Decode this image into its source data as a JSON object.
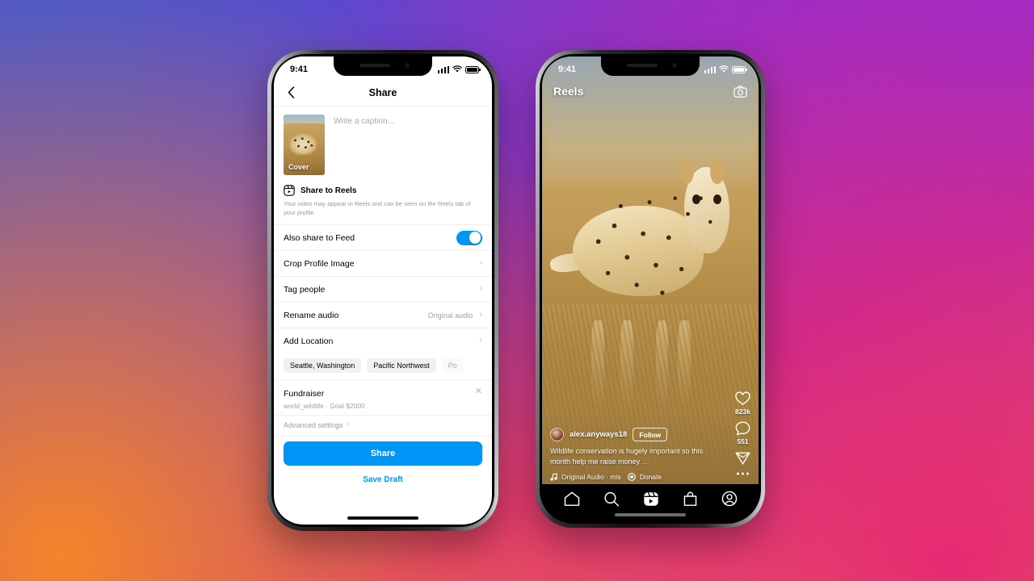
{
  "background": {
    "gradient_colors": [
      "#4055d4",
      "#5b45cf",
      "#a32bc4",
      "#d6297f",
      "#e62a72",
      "#f58529"
    ]
  },
  "accent": {
    "primary": "#0095f6",
    "toggle_on": "#0095f6"
  },
  "left_phone": {
    "status_bar": {
      "time": "9:41",
      "signal_icon": "cellular-bars-icon",
      "wifi_icon": "wifi-icon",
      "battery_icon": "battery-icon"
    },
    "nav": {
      "back_icon": "chevron-left-icon",
      "title": "Share"
    },
    "composer": {
      "cover_label": "Cover",
      "caption_placeholder": "Write a caption...",
      "caption_value": ""
    },
    "share_to_reels": {
      "icon": "reels-icon",
      "title": "Share to Reels",
      "description": "Your video may appear in Reels and can be seen on the Reels tab of your profile."
    },
    "settings_rows": [
      {
        "label": "Also share to Feed",
        "control": "toggle",
        "toggle_on": true
      },
      {
        "label": "Crop Profile Image",
        "control": "chevron",
        "value": ""
      },
      {
        "label": "Tag people",
        "control": "chevron",
        "value": ""
      },
      {
        "label": "Rename audio",
        "control": "chevron",
        "value": "Original audio"
      },
      {
        "label": "Add Location",
        "control": "chevron",
        "value": ""
      }
    ],
    "location_chips": [
      {
        "label": "Seattle, Washington",
        "cut_off": false
      },
      {
        "label": "Pacific Northwest",
        "cut_off": false
      },
      {
        "label": "Po",
        "cut_off": true
      }
    ],
    "fundraiser": {
      "title": "Fundraiser",
      "subtitle": "world_wildlife · Goal $2000",
      "remove_icon": "close-icon"
    },
    "advanced_settings": {
      "label": "Advanced settings",
      "chevron": "›"
    },
    "actions": {
      "share_label": "Share",
      "save_draft_label": "Save Draft"
    }
  },
  "right_phone": {
    "status_bar": {
      "time": "9:41",
      "signal_icon": "cellular-bars-icon",
      "wifi_icon": "wifi-icon",
      "battery_icon": "battery-icon"
    },
    "header": {
      "title": "Reels",
      "camera_icon": "camera-icon"
    },
    "action_rail": [
      {
        "icon": "heart-icon",
        "count": "823k"
      },
      {
        "icon": "comment-icon",
        "count": "551"
      },
      {
        "icon": "share-paperplane-icon",
        "count": ""
      },
      {
        "icon": "more-options-icon",
        "count": ""
      }
    ],
    "post": {
      "avatar": "user-avatar",
      "username": "alex.anyways18",
      "follow_label": "Follow",
      "caption": "Wildlife conservation is hugely important so this month help me raise money",
      "caption_more": "…",
      "audio_icon": "music-note-icon",
      "audio_label": "Original Audio · mis",
      "donate_icon": "donate-icon",
      "donate_label": "Donate"
    },
    "tabbar": [
      {
        "name": "home",
        "icon": "home-icon"
      },
      {
        "name": "search",
        "icon": "search-icon"
      },
      {
        "name": "reels",
        "icon": "reels-icon"
      },
      {
        "name": "shop",
        "icon": "shop-bag-icon"
      },
      {
        "name": "profile",
        "icon": "profile-circle-icon"
      }
    ]
  }
}
